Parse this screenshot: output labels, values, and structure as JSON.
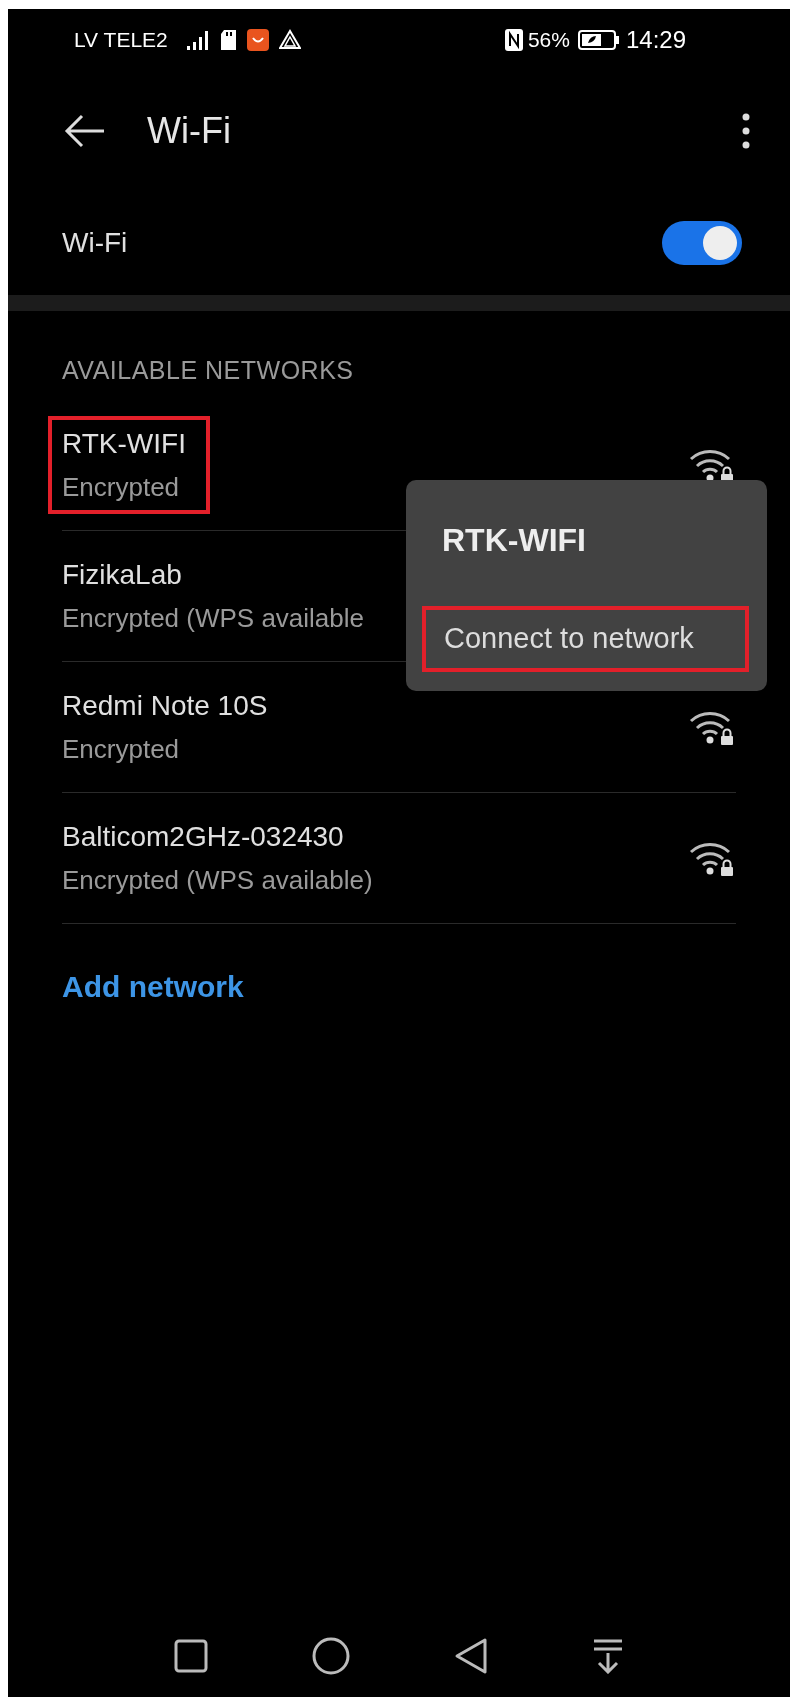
{
  "status_bar": {
    "carrier": "LV TELE2",
    "battery_percent": "56%",
    "time": "14:29"
  },
  "header": {
    "title": "Wi-Fi"
  },
  "wifi_switch": {
    "label": "Wi-Fi",
    "on": true
  },
  "section_title": "AVAILABLE NETWORKS",
  "networks": [
    {
      "name": "RTK-WIFI",
      "security": "Encrypted",
      "highlighted": true
    },
    {
      "name": "FizikaLab",
      "security": "Encrypted (WPS available",
      "highlighted": false
    },
    {
      "name": "Redmi Note 10S",
      "security": "Encrypted",
      "highlighted": false
    },
    {
      "name": "Balticom2GHz-032430",
      "security": "Encrypted (WPS available)",
      "highlighted": false
    }
  ],
  "add_network": "Add network",
  "popup_menu": {
    "title": "RTK-WIFI",
    "items": [
      {
        "label": "Connect to network",
        "highlighted": true
      }
    ]
  }
}
